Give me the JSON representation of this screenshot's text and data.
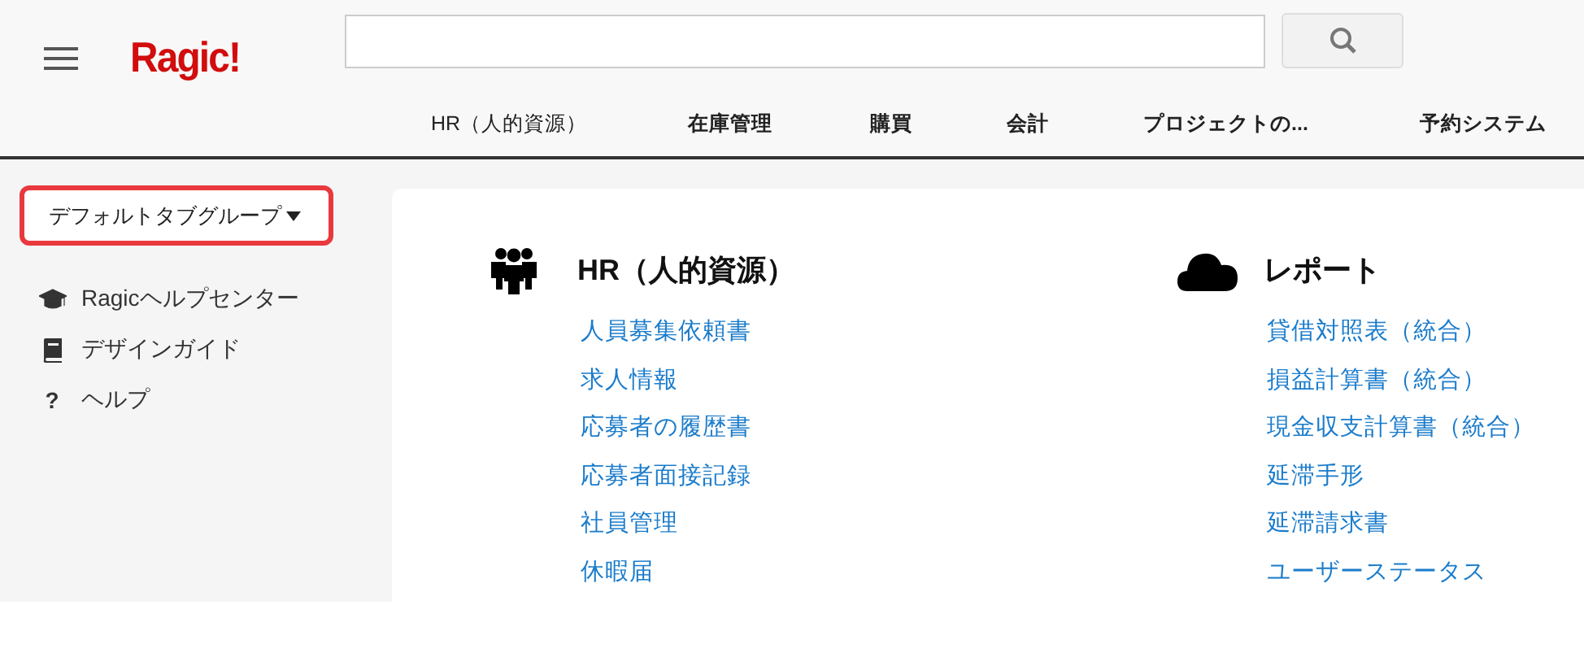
{
  "header": {
    "logo": "Ragic!",
    "tabs": [
      {
        "label": "HR（人的資源）",
        "selected": true
      },
      {
        "label": "在庫管理",
        "selected": false
      },
      {
        "label": "購買",
        "selected": false
      },
      {
        "label": "会計",
        "selected": false
      },
      {
        "label": "プロジェクトの...",
        "selected": false
      },
      {
        "label": "予約システム",
        "selected": false
      }
    ]
  },
  "sidebar": {
    "tab_group": {
      "label": "デフォルトタブグループ"
    },
    "items": [
      {
        "kind": "cap",
        "label": "Ragicヘルプセンター"
      },
      {
        "kind": "book",
        "label": "デザインガイド"
      },
      {
        "kind": "question",
        "label": "ヘルプ",
        "icon_text": "?"
      }
    ]
  },
  "sections": [
    {
      "kind": "people",
      "title": "HR（人的資源）",
      "links": [
        "人員募集依頼書",
        "求人情報",
        "応募者の履歴書",
        "応募者面接記録",
        "社員管理",
        "休暇届"
      ]
    },
    {
      "kind": "cloud",
      "title": "レポート",
      "links": [
        "貸借対照表（統合）",
        "損益計算書（統合）",
        "現金収支計算書（統合）",
        "延滞手形",
        "延滞請求書",
        "ユーザーステータス"
      ]
    }
  ]
}
